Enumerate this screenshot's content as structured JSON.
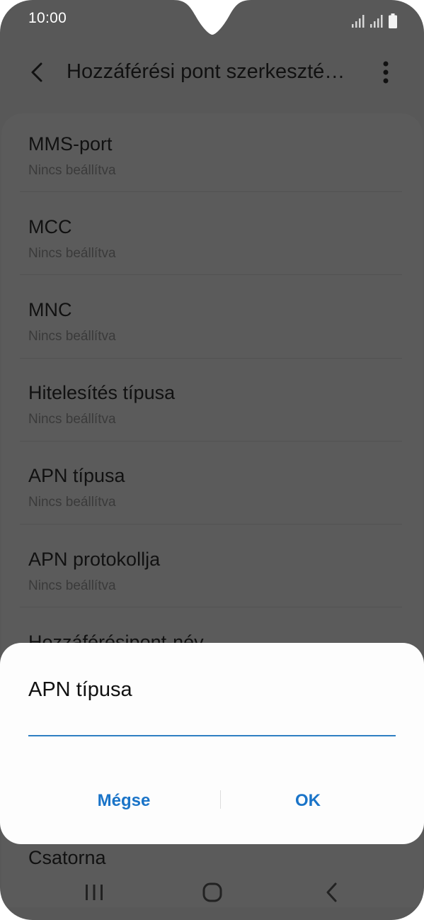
{
  "status_bar": {
    "time": "10:00",
    "icons": [
      "signal-icon",
      "signal-icon",
      "battery-icon"
    ]
  },
  "app_bar": {
    "title": "Hozzáférési pont szerkeszté…",
    "back_icon": "back-arrow-icon",
    "more_icon": "more-vert-icon"
  },
  "settings": {
    "items": [
      {
        "title": "MMS-port",
        "value": "Nincs beállítva"
      },
      {
        "title": "MCC",
        "value": "Nincs beállítva"
      },
      {
        "title": "MNC",
        "value": "Nincs beállítva"
      },
      {
        "title": "Hitelesítés típusa",
        "value": "Nincs beállítva"
      },
      {
        "title": "APN típusa",
        "value": "Nincs beállítva"
      },
      {
        "title": "APN protokollja",
        "value": "Nincs beállítva"
      },
      {
        "title": "Hozzáférésipont-név"
      },
      {
        "title": "Csatorna"
      }
    ]
  },
  "dialog": {
    "title": "APN típusa",
    "input_value": "",
    "cancel_label": "Mégse",
    "ok_label": "OK"
  },
  "nav_bar": {
    "icons": [
      "recent-apps-icon",
      "home-icon",
      "back-icon"
    ]
  },
  "colors": {
    "accent": "#1a74c8",
    "scrim_background": "#585858",
    "dialog_background": "#fdfdfd"
  }
}
